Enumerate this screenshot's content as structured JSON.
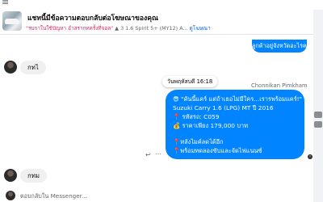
{
  "top_menu": {
    "icon": "menu-glyph-icon",
    "glyph": "≡"
  },
  "header": {
    "title": "แชทนี้มีข้อความตอบกลับต่อโฆษณาของคุณ",
    "subtitle_warn": "\"รบกาในใช้บัญหา อำสรากทครั้งที่จอล\"",
    "subtitle_info": "▲ 3 1.6 Spirit 5+ (MY12) A...",
    "subtitle_link": "ดูโฆษณา"
  },
  "messages": {
    "top_bubble_text": "ลูกค้าอยู่จังหวัดอะไรคะ",
    "incoming_1": "กทไ",
    "date_badge": "วันพฤหัสบดี 16:18",
    "sender_name": "Chonnikan Pimkham",
    "main_bubble": [
      "😎 \"คันนี้แคร์ แต่ถ้าเธอไม่มีใคร...เรารพร้อมแคร์!\"",
      "Suzuki Carry 1.6 (LPG) MT ปี 2016",
      "📍 รหัสรถ: C059",
      "💰 ราคาเพียง 179,000 บาท",
      "",
      "📍หลังไมค์ลดได้อีก",
      "📍พร้อมทดลองขับและจัดไฟแนนซ์"
    ],
    "incoming_2": "กทม"
  },
  "composer": {
    "placeholder": "ตอบกลับใน Messenger..."
  },
  "colors": {
    "accent": "#0084ff",
    "incoming_bg": "#f0f0f0",
    "link": "#0064d1"
  }
}
